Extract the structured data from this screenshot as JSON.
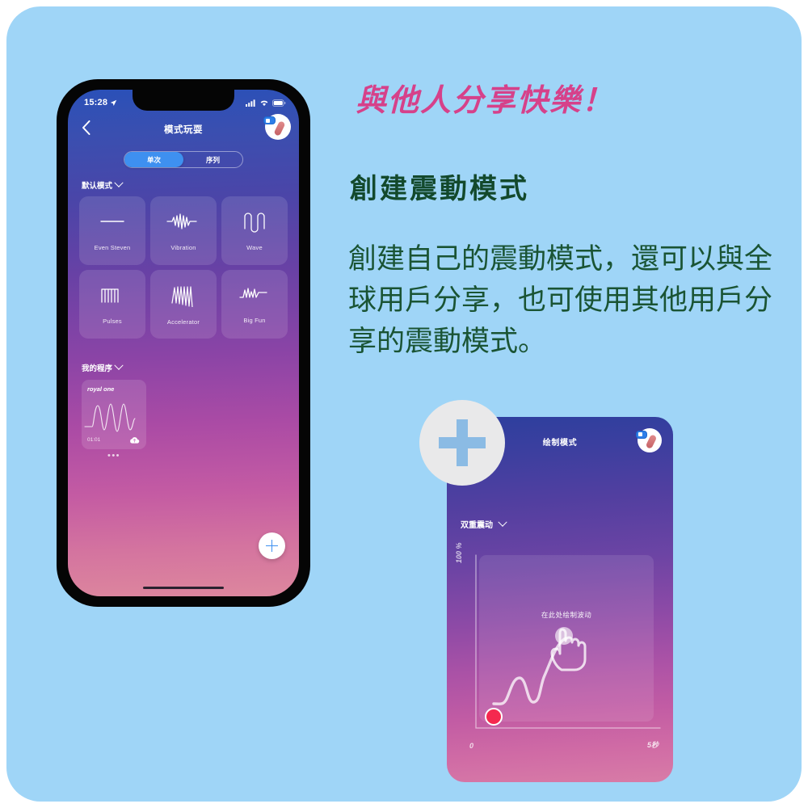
{
  "theme": {
    "background": "#9fd5f7",
    "headline_color": "#d6418a",
    "heading_color": "#13492c",
    "body_color": "#1a5434",
    "accent_blue": "#3e90f0",
    "marker_red": "#f5294f"
  },
  "promo": {
    "headline": "與他人分享快樂！",
    "subhead": "創建震動模式",
    "body": "創建自己的震動模式，還可以與全球用戶分享，也可使用其他用戶分享的震動模式。"
  },
  "phone": {
    "status": {
      "time": "15:28",
      "location_icon": "location-arrow-icon",
      "signal_icon": "cellular-signal-icon",
      "wifi_icon": "wifi-icon",
      "battery_icon": "battery-icon"
    },
    "nav": {
      "back_icon": "chevron-left-icon",
      "title": "模式玩耍",
      "toy_badge_icon": "toy-status-icon"
    },
    "segmented": {
      "options": [
        {
          "label": "单次",
          "active": true
        },
        {
          "label": "序列",
          "active": false
        }
      ]
    },
    "sections": {
      "default_patterns": "默认模式",
      "my_programs": "我的程序",
      "chevron_icon": "chevron-down-icon"
    },
    "patterns": [
      {
        "label": "Even Steven",
        "icon": "waveform-flat-icon"
      },
      {
        "label": "Vibration",
        "icon": "waveform-vibration-icon"
      },
      {
        "label": "Wave",
        "icon": "waveform-wave-icon"
      },
      {
        "label": "Pulses",
        "icon": "waveform-pulses-icon"
      },
      {
        "label": "Accelerator",
        "icon": "waveform-accelerator-icon"
      },
      {
        "label": "Big Fun",
        "icon": "waveform-bigfun-icon"
      }
    ],
    "program_card": {
      "name": "royal one",
      "duration": "01:01",
      "cloud_icon": "cloud-upload-icon",
      "more_icon": "more-dots-icon",
      "more_label": "•••"
    },
    "fab": {
      "label": "+",
      "icon": "plus-icon"
    },
    "home_indicator": "home-indicator"
  },
  "draw_card": {
    "title": "绘制模式",
    "toy_badge_icon": "toy-status-icon",
    "dual_mode_label": "双重震动",
    "dual_mode_chevron": "chevron-down-icon",
    "hint": "在此处绘制波动",
    "hand_icon": "pointing-hand-icon",
    "marker_icon": "red-dot-marker",
    "axes": {
      "y_label": "100 %",
      "x_min": "0",
      "x_max": "5秒"
    }
  },
  "add_button": {
    "icon": "plus-icon",
    "label": "+"
  },
  "chart_data": {
    "type": "line",
    "title": "在此处绘制波动",
    "xlabel": "",
    "ylabel": "100 %",
    "xlim": [
      0,
      5
    ],
    "ylim": [
      0,
      100
    ],
    "x_ticks": [
      "0",
      "5秒"
    ],
    "y_ticks": [
      "100 %"
    ],
    "grid": false,
    "legend": null,
    "series": [
      {
        "name": "drawn-intensity-curve",
        "x": [
          0.25,
          0.6,
          1.0,
          1.35,
          1.7,
          2.0,
          2.3,
          2.6,
          2.85,
          3.0
        ],
        "y": [
          4,
          14,
          34,
          30,
          13,
          8,
          30,
          58,
          72,
          78
        ]
      }
    ],
    "annotations": [
      {
        "label": "start-marker",
        "x": 0.25,
        "y": 4,
        "color": "#f5294f"
      }
    ]
  }
}
